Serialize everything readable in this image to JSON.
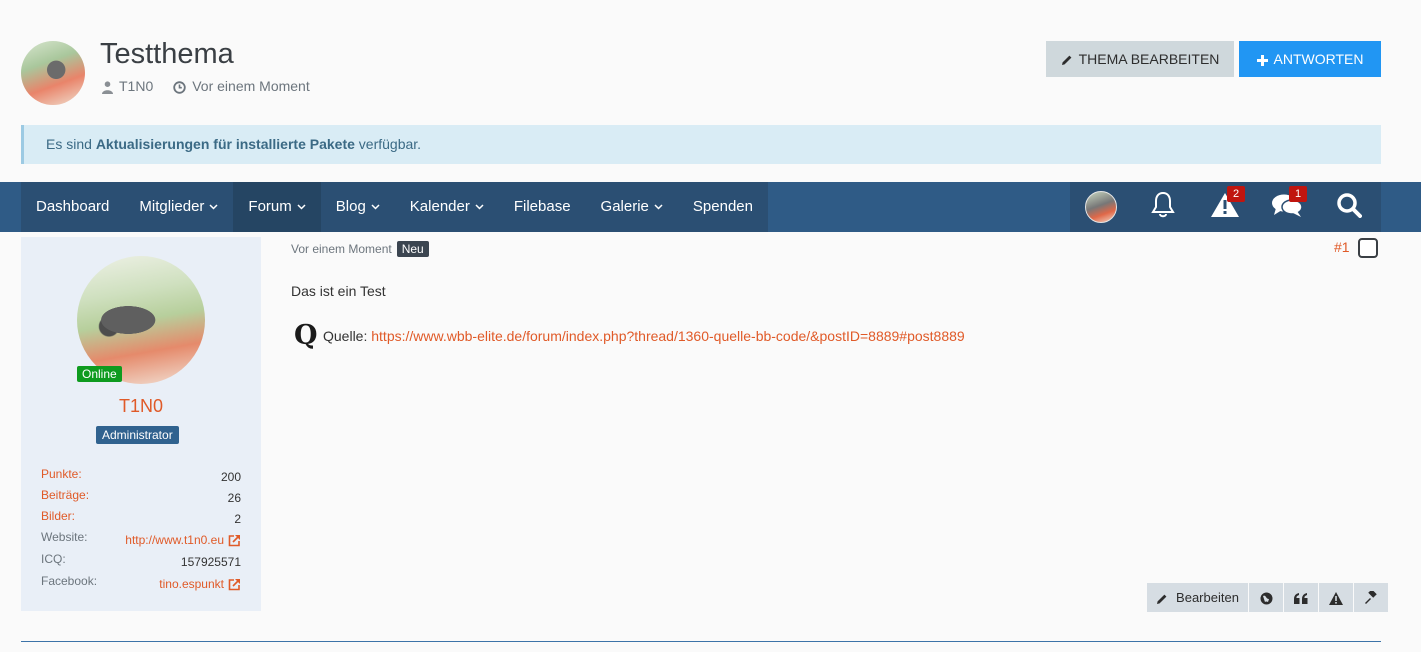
{
  "header": {
    "title": "Testthema",
    "author": "T1N0",
    "time": "Vor einem Moment",
    "edit_button": "THEMA BEARBEITEN",
    "reply_button": "ANTWORTEN"
  },
  "notice": {
    "prefix": "Es sind ",
    "bold": "Aktualisierungen für installierte Pakete",
    "suffix": " verfügbar."
  },
  "nav": {
    "items": [
      {
        "label": "Dashboard"
      },
      {
        "label": "Mitglieder"
      },
      {
        "label": "Forum"
      },
      {
        "label": "Blog"
      },
      {
        "label": "Kalender"
      },
      {
        "label": "Filebase"
      },
      {
        "label": "Galerie"
      },
      {
        "label": "Spenden"
      }
    ],
    "alerts_count": "2",
    "messages_count": "1"
  },
  "sidebar": {
    "online": "Online",
    "username": "T1N0",
    "rank": "Administrator",
    "stats": [
      {
        "label": "Punkte:",
        "value": "200"
      },
      {
        "label": "Beiträge:",
        "value": "26"
      },
      {
        "label": "Bilder:",
        "value": "2"
      },
      {
        "label": "Website:",
        "value": "http://www.t1n0.eu"
      },
      {
        "label": "ICQ:",
        "value": "157925571"
      },
      {
        "label": "Facebook:",
        "value": "tino.espunkt"
      }
    ]
  },
  "post": {
    "time": "Vor einem Moment",
    "badge": "Neu",
    "number": "#1",
    "text": "Das ist ein Test",
    "quelle_icon": "Q",
    "quelle_label": "Quelle: ",
    "quelle_url": "https://www.wbb-elite.de/forum/index.php?thread/1360-quelle-bb-code/&postID=8889#post8889",
    "edit_label": "Bearbeiten"
  },
  "colors": {
    "accent": "#e05a28",
    "nav": "#2f5b86",
    "reply": "#2196f3"
  }
}
